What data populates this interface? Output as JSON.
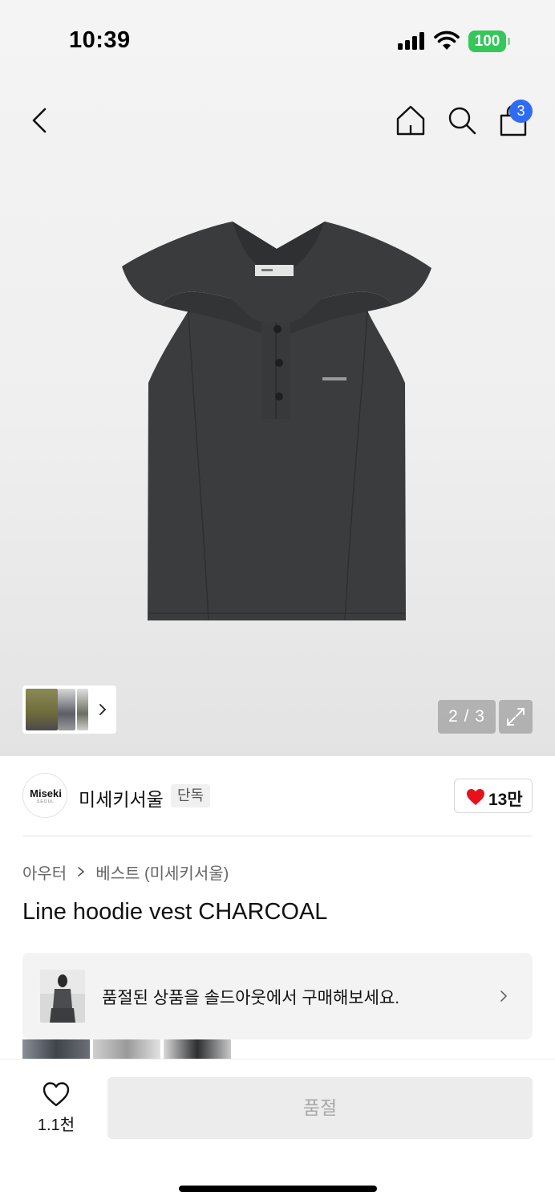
{
  "status_bar": {
    "time": "10:39",
    "battery": "100"
  },
  "nav": {
    "cart_count": "3"
  },
  "gallery": {
    "counter": "2 / 3"
  },
  "brand": {
    "logo_text": "Miseki",
    "logo_sub": "SEOUL",
    "name": "미세키서울",
    "badge": "단독",
    "likes": "13만"
  },
  "breadcrumb": {
    "category": "아우터",
    "subcategory": "베스트 (미세키서울)"
  },
  "product": {
    "title": "Line hoodie vest CHARCOAL"
  },
  "soldout_banner": {
    "text": "품절된 상품을 솔드아웃에서 구매해보세요."
  },
  "bottom_bar": {
    "wish_count": "1.1천",
    "buy_button": "품절"
  },
  "colors": {
    "accent_blue": "#2f6cf6",
    "heart_red": "#e8101d",
    "battery_green": "#34c759"
  }
}
